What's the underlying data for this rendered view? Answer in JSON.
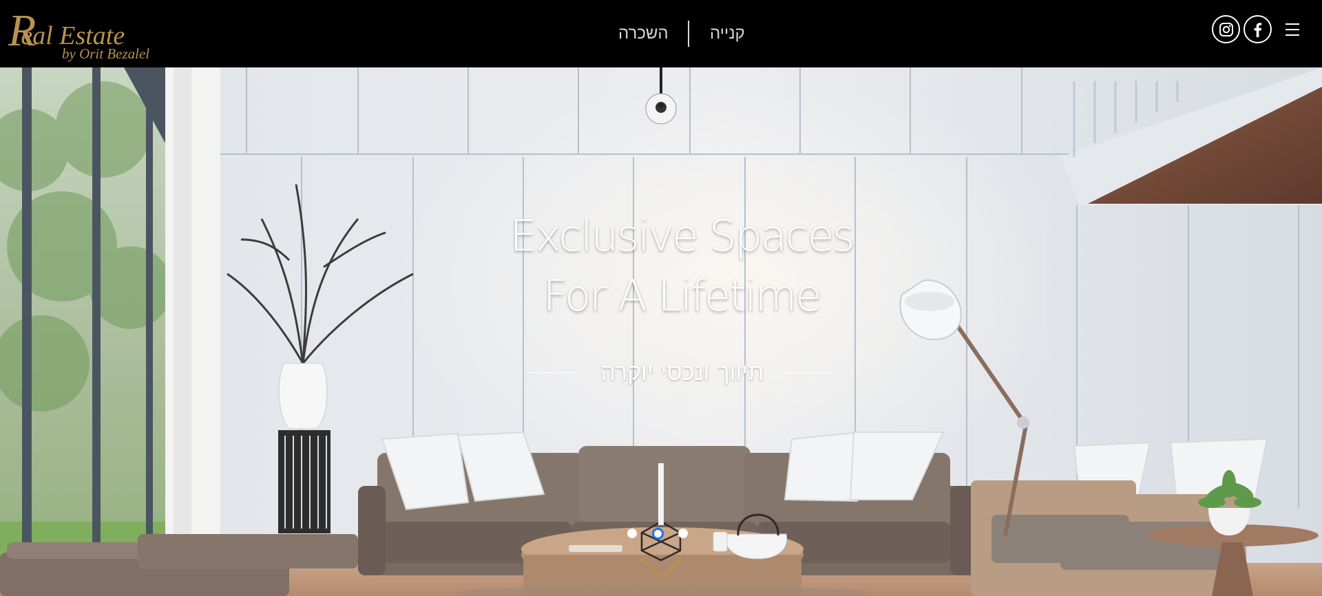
{
  "brand": {
    "logo_cap": "R",
    "logo_rest": "eal Estate",
    "logo_sub": "by Orit Bezalel",
    "accent": "#b8934f"
  },
  "nav": {
    "items": [
      {
        "label": "השכרה"
      },
      {
        "label": "קנייה"
      }
    ]
  },
  "header_icons": {
    "instagram": "instagram-icon",
    "facebook": "facebook-icon",
    "menu": "hamburger-menu-icon"
  },
  "hero": {
    "headline_line1": "Exclusive Spaces",
    "headline_line2": "For A Lifetime",
    "tagline": "תיווך ונכסי יוקרה",
    "slides": {
      "count": 3,
      "active": 2
    },
    "scroll_icon": "chevron-down-icon",
    "indicator_color": "#1a73e8"
  }
}
